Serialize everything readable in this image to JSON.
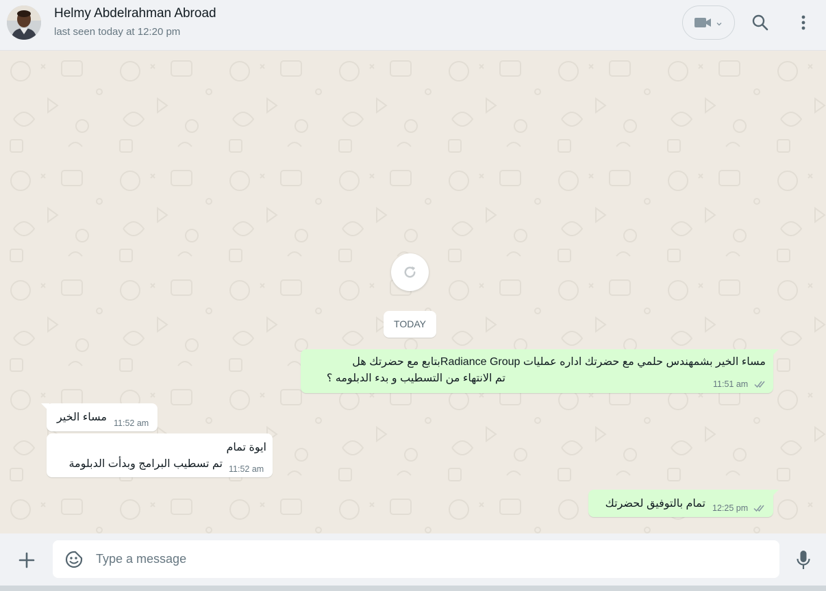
{
  "header": {
    "contact_name": "Helmy Abdelrahman Abroad",
    "status": "last seen today at 12:20 pm",
    "icons": [
      "video-call-icon",
      "chevron-down-icon",
      "search-icon",
      "menu-icon"
    ]
  },
  "chat": {
    "date_divider": "TODAY",
    "messages": [
      {
        "direction": "outgoing",
        "lines": [
          "مساء الخير بشمهندس  حلمي مع  حضرتك اداره عمليات Radiance Groupبتابع مع حضرتك هل",
          "تم الانتهاء من التسطيب و بدء الدبلومه ؟"
        ],
        "time": "11:51 am",
        "status": "read"
      },
      {
        "direction": "incoming",
        "lines": [
          "مساء الخير"
        ],
        "time": "11:52 am"
      },
      {
        "direction": "incoming",
        "lines": [
          "ايوة تمام",
          "تم تسطيب البرامج وبدأت الدبلومة"
        ],
        "time": "11:52 am"
      },
      {
        "direction": "outgoing",
        "lines": [
          "تمام بالتوفيق لحضرتك"
        ],
        "time": "12:25 pm",
        "status": "read"
      }
    ]
  },
  "composer": {
    "placeholder": "Type a message",
    "icons": [
      "plus-icon",
      "emoji-icon",
      "microphone-icon"
    ]
  },
  "colors": {
    "header_bg": "#f0f2f5",
    "chat_bg": "#efeae2",
    "outgoing_bubble": "#d9fdd3",
    "incoming_bubble": "#ffffff",
    "read_ticks": "#8696a0"
  }
}
